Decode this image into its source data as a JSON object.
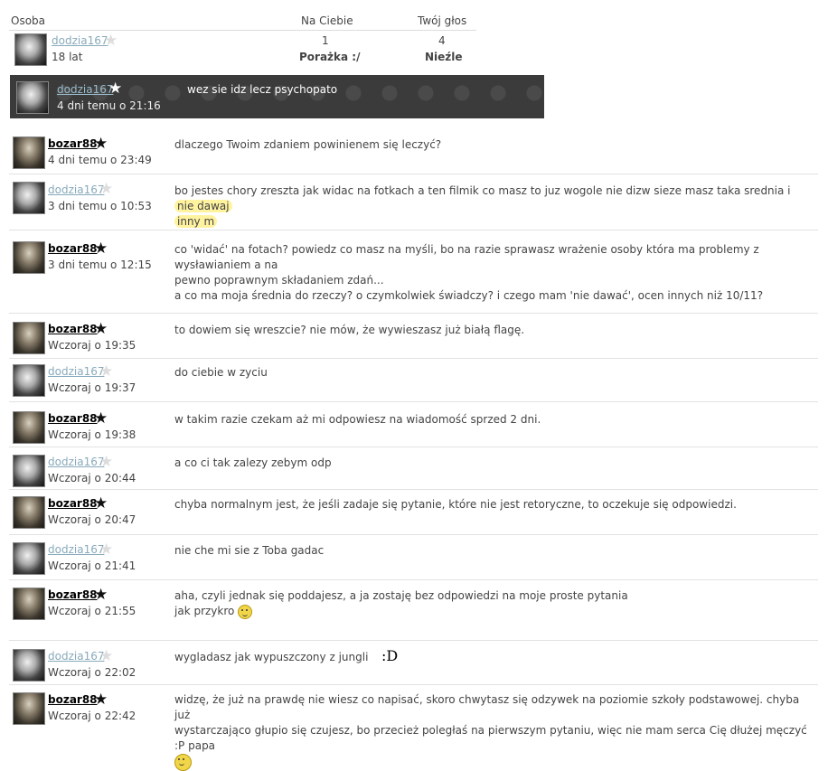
{
  "header": {
    "col_osoba": "Osoba",
    "col_na_ciebie": "Na Ciebie",
    "col_twoj_glos": "Twój głos"
  },
  "profile": {
    "name": "dodzia167",
    "age": "18 lat",
    "na_ciebie_value": "1",
    "na_ciebie_label": "Porażka :/",
    "twoj_glos_value": "4",
    "twoj_glos_label": "Nieźle"
  },
  "banner": {
    "name": "dodzia167",
    "time": "4 dni temu o 21:16",
    "text": "wez sie idz lecz psychopato"
  },
  "messages": [
    {
      "author": "bozar88",
      "time": "4 dni temu o 23:49",
      "text": "dlaczego Twoim zdaniem powinienem się leczyć?"
    },
    {
      "author": "dodzia167",
      "time": "3 dni temu o 10:53",
      "text_a": "bo jestes chory zreszta jak widac na fotkach a ten filmik co masz to juz wogole nie dizw sieze masz taka srednia i ",
      "text_hl1": "nie dawaj",
      "text_hl2": "inny m"
    },
    {
      "author": "bozar88",
      "time": "3 dni temu o 12:15",
      "line1": "co 'widać' na fotach? powiedz co masz na myśli, bo na razie sprawasz wrażenie osoby która ma problemy z wysławianiem a na",
      "line2": "pewno poprawnym składaniem zdań...",
      "line3": "a co ma moja średnia do rzeczy? o czymkolwiek świadczy? i czego mam 'nie dawać', ocen innych niż 10/11?"
    },
    {
      "author": "bozar88",
      "time": "Wczoraj o 19:35",
      "text": "to dowiem się wreszcie? nie mów, że wywieszasz już białą flagę."
    },
    {
      "author": "dodzia167",
      "time": "Wczoraj o 19:37",
      "text": "do ciebie w zyciu"
    },
    {
      "author": "bozar88",
      "time": "Wczoraj o 19:38",
      "text": "w takim razie czekam aż mi odpowiesz na wiadomość sprzed 2 dni."
    },
    {
      "author": "dodzia167",
      "time": "Wczoraj o 20:44",
      "text": "a co ci tak zalezy zebym odp"
    },
    {
      "author": "bozar88",
      "time": "Wczoraj o 20:47",
      "text": "chyba normalnym jest, że jeśli zadaje się pytanie, które nie jest retoryczne, to oczekuje się odpowiedzi."
    },
    {
      "author": "dodzia167",
      "time": "Wczoraj o 21:41",
      "text": "nie che mi sie z Toba gadac"
    },
    {
      "author": "bozar88",
      "time": "Wczoraj o 21:55",
      "line1": "aha, czyli jednak się poddajesz, a ja zostaję bez odpowiedzi na moje proste pytania",
      "line2": "jak przykro"
    },
    {
      "author": "dodzia167",
      "time": "Wczoraj o 22:02",
      "text": "wygladasz jak wypuszczony z jungli",
      "extra": ":D"
    },
    {
      "author": "bozar88",
      "time": "Wczoraj o 22:42",
      "line1": "widzę, że już na prawdę nie wiesz co napisać, skoro chwytasz się odzywek na poziomie szkoły podstawowej. chyba już",
      "line2": "wystarczająco głupio się czujesz, bo przecież poległaś na pierwszym pytaniu, więc nie mam serca Cię dłużej męczyć :P papa"
    }
  ],
  "icons": {
    "star": "star-icon",
    "smiley": "smiley-icon"
  }
}
